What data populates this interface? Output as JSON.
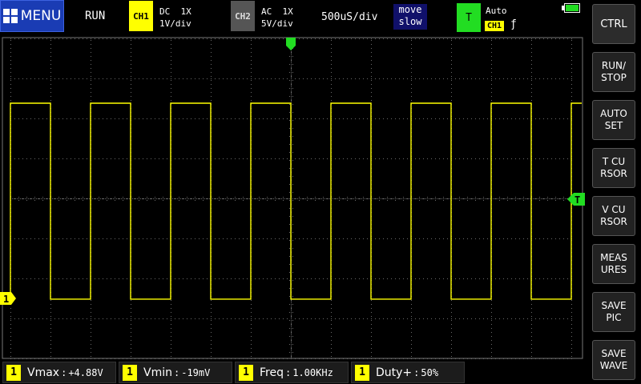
{
  "header": {
    "menu_label": "MENU",
    "run_state": "RUN",
    "ch1": {
      "badge": "CH1",
      "coupling": "DC  1X",
      "scale": "1V/div"
    },
    "ch2": {
      "badge": "CH2",
      "coupling": "AC  1X",
      "scale": "5V/div"
    },
    "timebase": "500uS/div",
    "move_mode": {
      "line1": "move",
      "line2": "slow"
    },
    "trigger": {
      "badge": "T",
      "mode": "Auto",
      "source": "CH1",
      "edge": "ƒ"
    },
    "battery_level": 1.0
  },
  "screen": {
    "ch1_marker": "1",
    "trigger_marker": "T",
    "trigger_position_marker": "▼",
    "colors": {
      "trace": "#ffff00",
      "trigger": "#22dd22",
      "grid": "#6a6a6a"
    },
    "waveform": {
      "type": "square",
      "frequency_khz": 1.0,
      "duty_percent": 50,
      "high_v": 4.88,
      "low_v": -0.019
    }
  },
  "side_buttons": [
    {
      "label": "CTRL"
    },
    {
      "label": "RUN/\nSTOP"
    },
    {
      "label": "AUTO\nSET"
    },
    {
      "label": "T CU\nRSOR"
    },
    {
      "label": "V CU\nRSOR"
    },
    {
      "label": "MEAS\nURES"
    },
    {
      "label": "SAVE\nPIC"
    },
    {
      "label": "SAVE\nWAVE"
    }
  ],
  "measurements": [
    {
      "channel": "1",
      "name": "Vmax",
      "value": "+4.88V"
    },
    {
      "channel": "1",
      "name": "Vmin",
      "value": "-19mV"
    },
    {
      "channel": "1",
      "name": "Freq",
      "value": "1.00KHz"
    },
    {
      "channel": "1",
      "name": "Duty+",
      "value": "50%"
    }
  ]
}
